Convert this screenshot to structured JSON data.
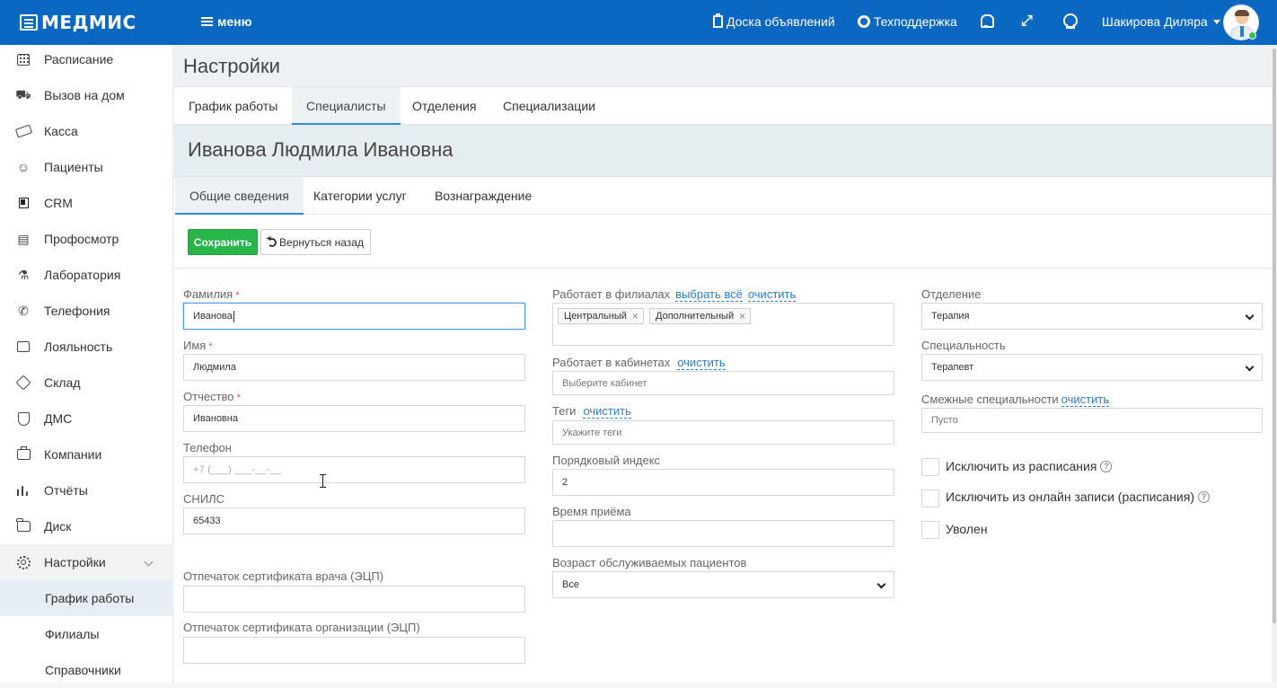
{
  "topbar": {
    "logo": "МЕДМИС",
    "menu_label": "меню",
    "board_label": "Доска объявлений",
    "support_label": "Техподдержка",
    "user_name": "Шакирова Диляра"
  },
  "sidebar": {
    "items": [
      {
        "label": "Расписание",
        "icon": "calendar-icon"
      },
      {
        "label": "Вызов на дом",
        "icon": "ambulance-icon"
      },
      {
        "label": "Касса",
        "icon": "cash-icon"
      },
      {
        "label": "Пациенты",
        "icon": "patients-icon"
      },
      {
        "label": "CRM",
        "icon": "crm-icon"
      },
      {
        "label": "Профосмотр",
        "icon": "book-icon"
      },
      {
        "label": "Лаборатория",
        "icon": "microscope-icon"
      },
      {
        "label": "Телефония",
        "icon": "phone-icon"
      },
      {
        "label": "Лояльность",
        "icon": "gift-icon"
      },
      {
        "label": "Склад",
        "icon": "box-icon"
      },
      {
        "label": "ДМС",
        "icon": "shield-icon"
      },
      {
        "label": "Компании",
        "icon": "briefcase-icon"
      },
      {
        "label": "Отчёты",
        "icon": "chart-icon"
      },
      {
        "label": "Диск",
        "icon": "folder-icon"
      },
      {
        "label": "Настройки",
        "icon": "gear-icon"
      }
    ],
    "sub_items": [
      {
        "label": "График работы"
      },
      {
        "label": "Филиалы"
      },
      {
        "label": "Справочники"
      }
    ]
  },
  "page": {
    "title": "Настройки",
    "tabs": [
      "График работы",
      "Специалисты",
      "Отделения",
      "Специализации"
    ],
    "active_tab": "Специалисты"
  },
  "person": {
    "name": "Иванова Людмила Ивановна",
    "tabs": [
      "Общие сведения",
      "Категории услуг",
      "Вознаграждение"
    ],
    "active_tab": "Общие сведения"
  },
  "toolbar": {
    "save_label": "Сохранить",
    "back_label": "Вернуться назад"
  },
  "form": {
    "surname_label": "Фамилия",
    "surname_value": "Иванова",
    "name_label": "Имя",
    "name_value": "Людмила",
    "patronymic_label": "Отчество",
    "patronymic_value": "Ивановна",
    "phone_label": "Телефон",
    "phone_mask": "+7 (___) ___-__-__",
    "snils_label": "СНИЛС",
    "snils_value": "65433",
    "doctor_cert_label": "Отпечаток сертификата врача (ЭЦП)",
    "org_cert_label": "Отпечаток сертификата организации (ЭЦП)",
    "branches_label": "Работает в филиалах",
    "select_all_link": "выбрать всё",
    "clear_link": "очистить",
    "branches": [
      "Центральный",
      "Дополнительный"
    ],
    "cabinets_label": "Работает в кабинетах",
    "cabinets_placeholder": "Выберите кабинет",
    "tags_label": "Теги",
    "tags_placeholder": "Укажите теги",
    "order_label": "Порядковый индекс",
    "order_value": "2",
    "reception_label": "Время приёма",
    "age_label": "Возраст обслуживаемых пациентов",
    "age_value": "Все",
    "department_label": "Отделение",
    "department_value": "Терапия",
    "specialty_label": "Специальность",
    "specialty_value": "Терапевт",
    "related_label": "Смежные специальности",
    "related_placeholder": "Пусто",
    "cb_exclude_schedule": "Исключить из расписания",
    "cb_exclude_online": "Исключить из онлайн записи (расписания)",
    "cb_fired": "Уволен",
    "help_glyph": "?"
  }
}
